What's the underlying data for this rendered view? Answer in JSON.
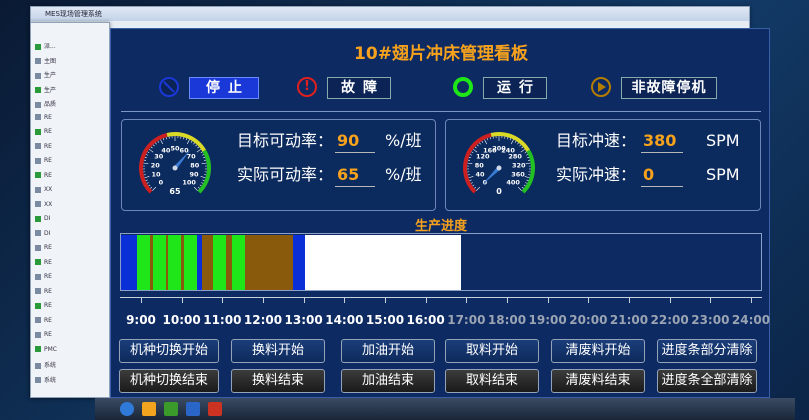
{
  "background_windows": {
    "browser_tab_title": "MES现场管理系统",
    "sidebar_items": [
      "派...",
      "主图",
      "生产",
      "生产",
      "品质",
      "RE",
      "RE",
      "RE",
      "RE",
      "RE",
      "XX",
      "XX",
      "DI",
      "DI",
      "RE",
      "RE",
      "RE",
      "RE",
      "RE",
      "RE",
      "RE",
      "PMC",
      "系统",
      "系统"
    ]
  },
  "board": {
    "title": "10#翅片冲床管理看板",
    "status": {
      "stop": "停止",
      "fault": "故障",
      "running": "运行",
      "non_fault_stop": "非故障停机"
    },
    "left_panel": {
      "gauge_value": "65",
      "gauge_ticks": [
        "0",
        "10",
        "20",
        "30",
        "40",
        "50",
        "60",
        "70",
        "80",
        "90",
        "100"
      ],
      "target_label": "目标可动率：",
      "target_value": "90",
      "actual_label": "实际可动率：",
      "actual_value": "65",
      "unit": "%/班"
    },
    "right_panel": {
      "gauge_value": "0",
      "gauge_ticks": [
        "0",
        "40",
        "80",
        "120",
        "160",
        "200",
        "240",
        "280",
        "320",
        "360",
        "400"
      ],
      "target_label": "目标冲速：",
      "target_value": "380",
      "actual_label": "实际冲速：",
      "actual_value": "0",
      "unit": "SPM"
    },
    "progress_title": "生产进度",
    "progress_segments": [
      {
        "color": "#0a2fd6",
        "start": 0.0,
        "end": 0.025
      },
      {
        "color": "#1ee619",
        "start": 0.025,
        "end": 0.046
      },
      {
        "color": "#8a5a0c",
        "start": 0.046,
        "end": 0.05
      },
      {
        "color": "#1ee619",
        "start": 0.05,
        "end": 0.07
      },
      {
        "color": "#8a5a0c",
        "start": 0.07,
        "end": 0.074
      },
      {
        "color": "#1ee619",
        "start": 0.074,
        "end": 0.093
      },
      {
        "color": "#8a5a0c",
        "start": 0.093,
        "end": 0.098
      },
      {
        "color": "#1ee619",
        "start": 0.098,
        "end": 0.118
      },
      {
        "color": "#0a2fd6",
        "start": 0.118,
        "end": 0.126
      },
      {
        "color": "#8a5a0c",
        "start": 0.126,
        "end": 0.143
      },
      {
        "color": "#1ee619",
        "start": 0.143,
        "end": 0.164
      },
      {
        "color": "#8a5a0c",
        "start": 0.164,
        "end": 0.174
      },
      {
        "color": "#1ee619",
        "start": 0.174,
        "end": 0.193
      },
      {
        "color": "#8a5a0c",
        "start": 0.193,
        "end": 0.268
      },
      {
        "color": "#0a2fd6",
        "start": 0.268,
        "end": 0.287
      },
      {
        "color": "#ffffff",
        "start": 0.287,
        "end": 0.532
      }
    ],
    "time_axis": [
      {
        "label": "9:00",
        "past": true
      },
      {
        "label": "10:00",
        "past": true
      },
      {
        "label": "11:00",
        "past": true
      },
      {
        "label": "12:00",
        "past": true
      },
      {
        "label": "13:00",
        "past": true
      },
      {
        "label": "14:00",
        "past": true
      },
      {
        "label": "15:00",
        "past": true
      },
      {
        "label": "16:00",
        "past": true
      },
      {
        "label": "17:00",
        "past": false
      },
      {
        "label": "18:00",
        "past": false
      },
      {
        "label": "19:00",
        "past": false
      },
      {
        "label": "20:00",
        "past": false
      },
      {
        "label": "21:00",
        "past": false
      },
      {
        "label": "22:00",
        "past": false
      },
      {
        "label": "23:00",
        "past": false
      },
      {
        "label": "24:00",
        "past": false
      }
    ],
    "buttons_row1": [
      "机种切换开始",
      "换料开始",
      "加油开始",
      "取料开始",
      "清废料开始",
      "进度条部分清除"
    ],
    "buttons_row2": [
      "机种切换结束",
      "换料结束",
      "加油结束",
      "取料结束",
      "清废料结束",
      "进度条全部清除"
    ]
  },
  "colors": {
    "accent": "#f7a21c",
    "panel_bg": "#0d2a63",
    "running_green": "#1ee619",
    "fault_red": "#e0201c",
    "stop_blue": "#1a38d8"
  }
}
